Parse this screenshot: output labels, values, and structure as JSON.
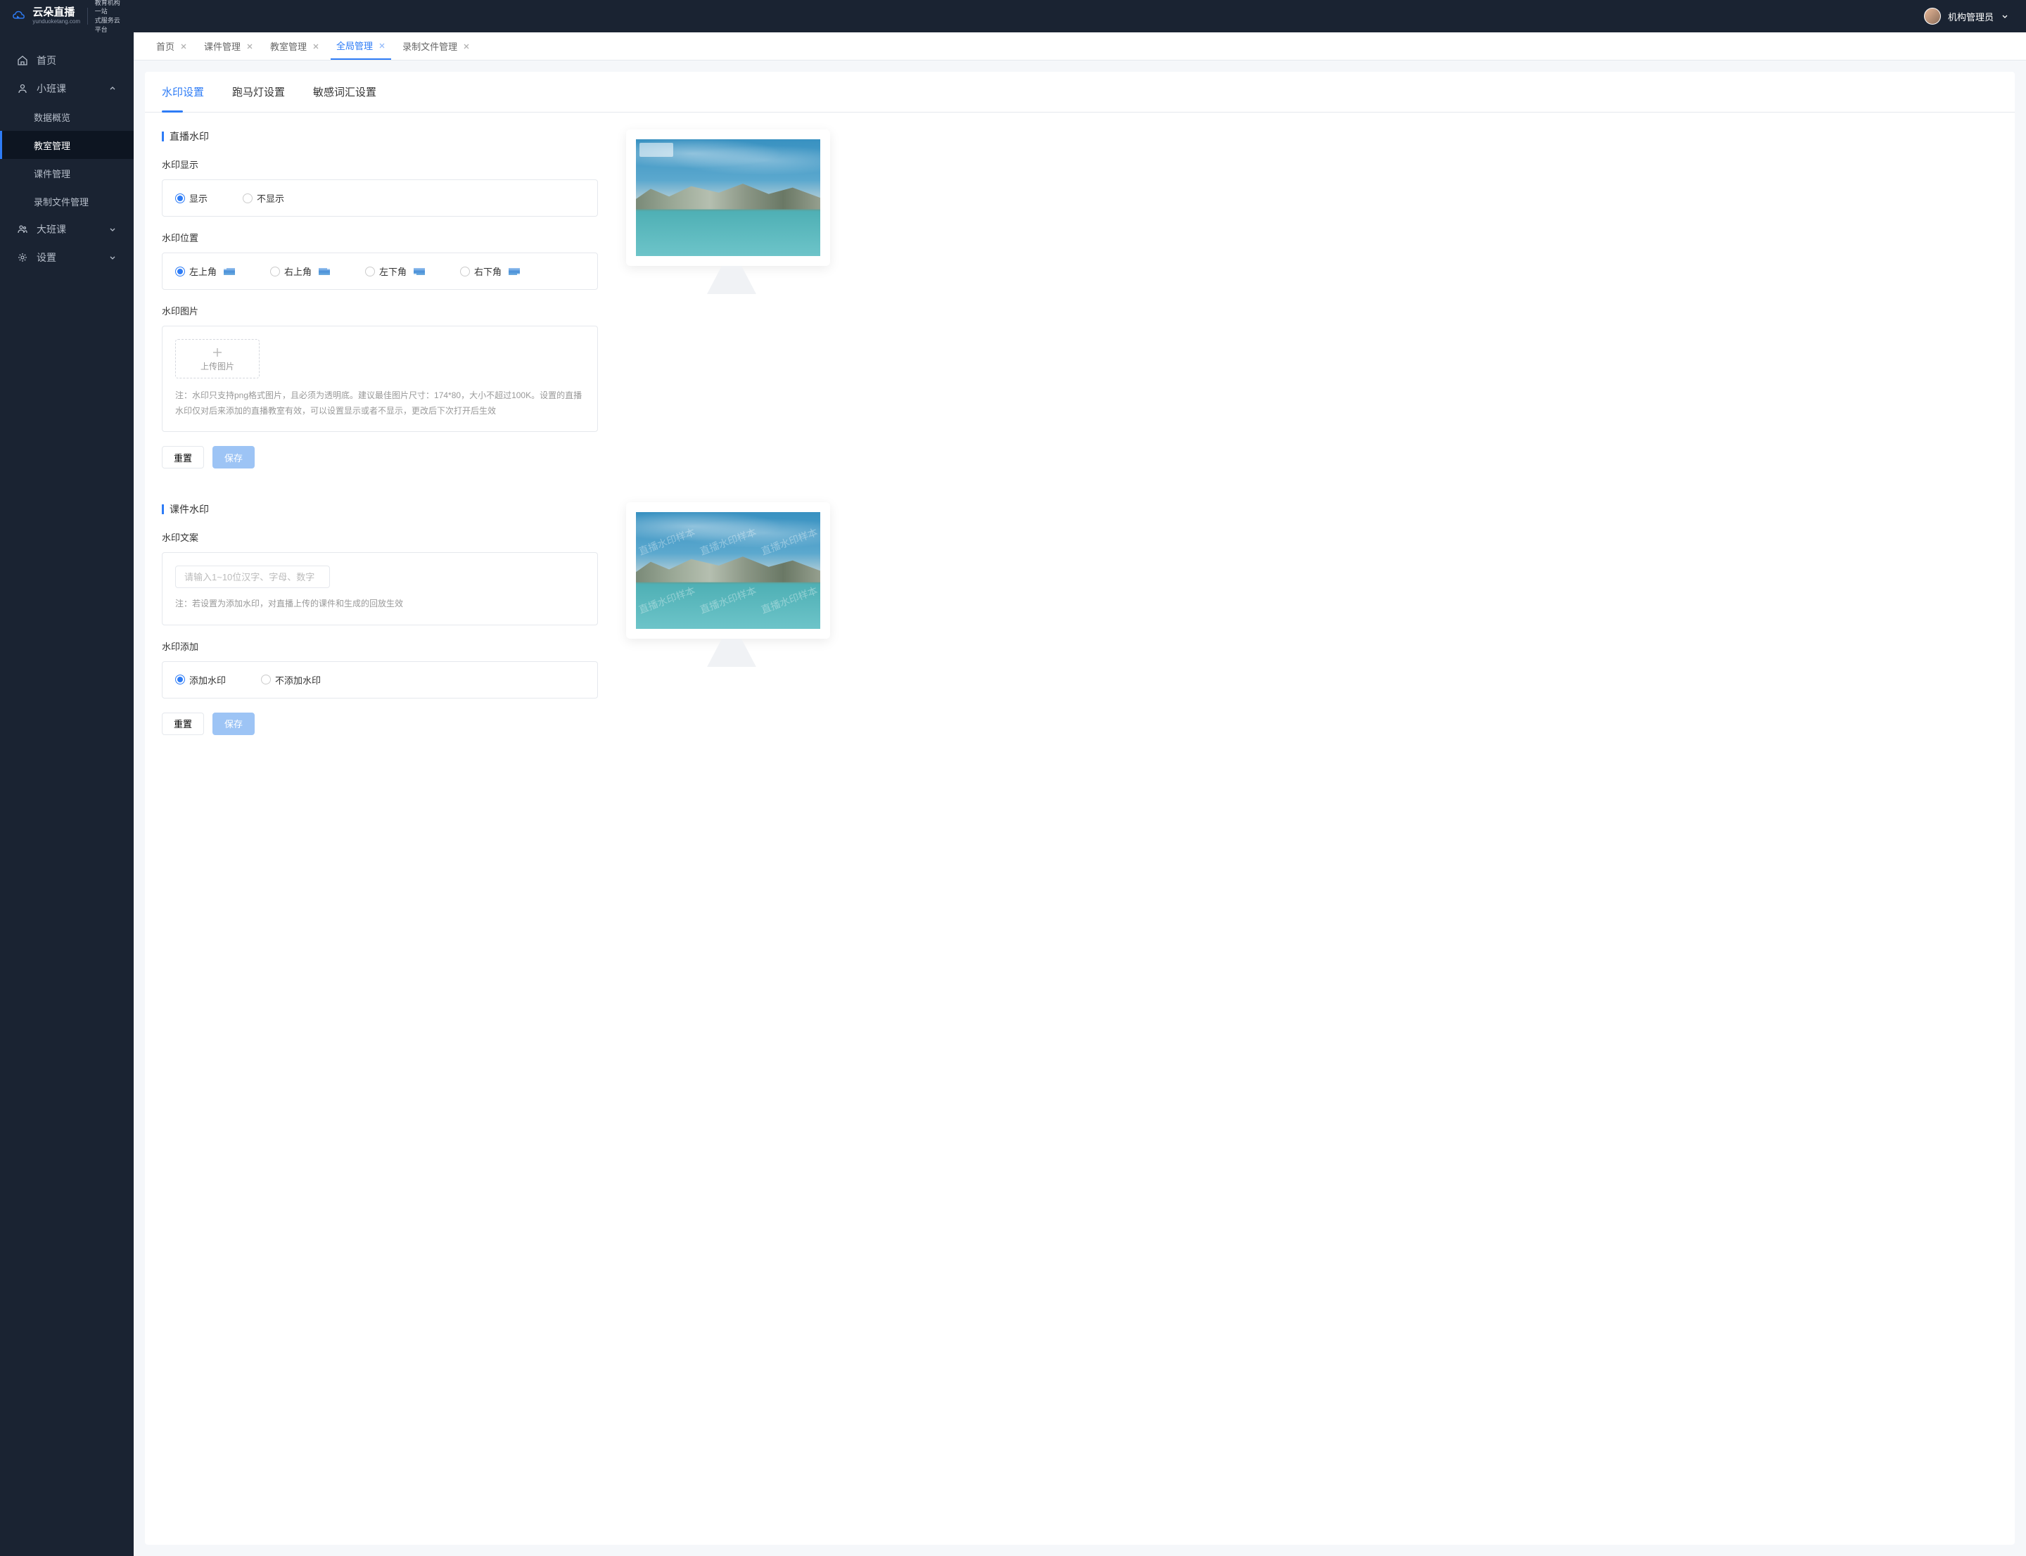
{
  "logo": {
    "main": "云朵直播",
    "sub": "yunduoketang.com",
    "tagline1": "教育机构一站",
    "tagline2": "式服务云平台"
  },
  "user": {
    "name": "机构管理员"
  },
  "sidebar": {
    "items": [
      {
        "label": "首页",
        "icon": "home"
      },
      {
        "label": "小班课",
        "icon": "users",
        "expanded": true
      },
      {
        "label": "数据概览",
        "sub": true
      },
      {
        "label": "教室管理",
        "sub": true,
        "active": true
      },
      {
        "label": "课件管理",
        "sub": true
      },
      {
        "label": "录制文件管理",
        "sub": true
      },
      {
        "label": "大班课",
        "icon": "users2"
      },
      {
        "label": "设置",
        "icon": "gear"
      }
    ]
  },
  "breadcrumbTabs": [
    {
      "label": "首页"
    },
    {
      "label": "课件管理"
    },
    {
      "label": "教室管理"
    },
    {
      "label": "全局管理",
      "active": true
    },
    {
      "label": "录制文件管理"
    }
  ],
  "contentTabs": [
    {
      "label": "水印设置",
      "active": true
    },
    {
      "label": "跑马灯设置"
    },
    {
      "label": "敏感词汇设置"
    }
  ],
  "live": {
    "title": "直播水印",
    "displayLabel": "水印显示",
    "displayOptions": {
      "show": "显示",
      "hide": "不显示"
    },
    "positionLabel": "水印位置",
    "positions": {
      "tl": "左上角",
      "tr": "右上角",
      "bl": "左下角",
      "br": "右下角"
    },
    "imageLabel": "水印图片",
    "uploadText": "上传图片",
    "hint": "注：水印只支持png格式图片，且必须为透明底。建议最佳图片尺寸：174*80，大小不超过100K。设置的直播水印仅对后来添加的直播教室有效，可以设置显示或者不显示，更改后下次打开后生效",
    "reset": "重置",
    "save": "保存"
  },
  "courseware": {
    "title": "课件水印",
    "textLabel": "水印文案",
    "placeholder": "请输入1~10位汉字、字母、数字",
    "hint": "注：若设置为添加水印，对直播上传的课件和生成的回放生效",
    "addLabel": "水印添加",
    "addOptions": {
      "yes": "添加水印",
      "no": "不添加水印"
    },
    "reset": "重置",
    "save": "保存",
    "sample": "直播水印样本"
  }
}
